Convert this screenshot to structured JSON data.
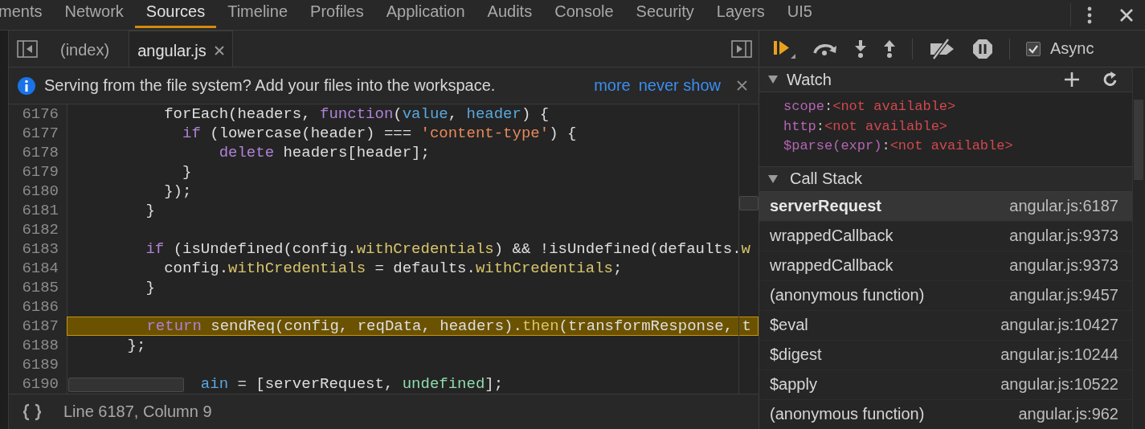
{
  "top_tabs": [
    {
      "label": "ments",
      "selected": false
    },
    {
      "label": "Network",
      "selected": false
    },
    {
      "label": "Sources",
      "selected": true
    },
    {
      "label": "Timeline",
      "selected": false
    },
    {
      "label": "Profiles",
      "selected": false
    },
    {
      "label": "Application",
      "selected": false
    },
    {
      "label": "Audits",
      "selected": false
    },
    {
      "label": "Console",
      "selected": false
    },
    {
      "label": "Security",
      "selected": false
    },
    {
      "label": "Layers",
      "selected": false
    },
    {
      "label": "UI5",
      "selected": false
    }
  ],
  "file_tabs": [
    {
      "label": "(index)",
      "selected": false,
      "closable": false
    },
    {
      "label": "angular.js",
      "selected": true,
      "closable": true
    }
  ],
  "infobar": {
    "message": "Serving from the file system? Add your files into the workspace.",
    "links": [
      "more",
      "never show"
    ]
  },
  "editor": {
    "lines": [
      {
        "number": "6176",
        "current": false,
        "tokens": [
          {
            "kind": "plain",
            "text": "        forEach(headers, "
          },
          {
            "kind": "keyword",
            "text": "function"
          },
          {
            "kind": "plain",
            "text": "("
          },
          {
            "kind": "param",
            "text": "value"
          },
          {
            "kind": "plain",
            "text": ", "
          },
          {
            "kind": "param",
            "text": "header"
          },
          {
            "kind": "plain",
            "text": ") {"
          }
        ]
      },
      {
        "number": "6177",
        "current": false,
        "tokens": [
          {
            "kind": "keyword",
            "text": "          if"
          },
          {
            "kind": "plain",
            "text": " (lowercase(header) === "
          },
          {
            "kind": "string",
            "text": "'content-type'"
          },
          {
            "kind": "plain",
            "text": ") {"
          }
        ]
      },
      {
        "number": "6178",
        "current": false,
        "tokens": [
          {
            "kind": "keyword",
            "text": "              delete"
          },
          {
            "kind": "plain",
            "text": " headers[header];"
          }
        ]
      },
      {
        "number": "6179",
        "current": false,
        "tokens": [
          {
            "kind": "plain",
            "text": "          }"
          }
        ]
      },
      {
        "number": "6180",
        "current": false,
        "tokens": [
          {
            "kind": "plain",
            "text": "        });"
          }
        ]
      },
      {
        "number": "6181",
        "current": false,
        "tokens": [
          {
            "kind": "plain",
            "text": "      }"
          }
        ]
      },
      {
        "number": "6182",
        "current": false
      },
      {
        "number": "6183",
        "current": false,
        "tokens": [
          {
            "kind": "keyword",
            "text": "      if"
          },
          {
            "kind": "plain",
            "text": " (isUndefined(config."
          },
          {
            "kind": "property",
            "text": "withCredentials"
          },
          {
            "kind": "plain",
            "text": ") && !isUndefined(defaults."
          },
          {
            "kind": "property",
            "text": "w"
          }
        ]
      },
      {
        "number": "6184",
        "current": false,
        "tokens": [
          {
            "kind": "plain",
            "text": "        config."
          },
          {
            "kind": "property",
            "text": "withCredentials"
          },
          {
            "kind": "plain",
            "text": " = defaults."
          },
          {
            "kind": "property",
            "text": "withCredentials"
          },
          {
            "kind": "plain",
            "text": ";"
          }
        ]
      },
      {
        "number": "6185",
        "current": false,
        "tokens": [
          {
            "kind": "plain",
            "text": "      }"
          }
        ]
      },
      {
        "number": "6186",
        "current": false
      },
      {
        "number": "6187",
        "current": true,
        "tokens": [
          {
            "kind": "keyword",
            "text": "      return"
          },
          {
            "kind": "plain",
            "text": " sendReq(config, reqData, headers)."
          },
          {
            "kind": "property",
            "text": "then"
          },
          {
            "kind": "plain",
            "text": "(transformResponse, t"
          }
        ]
      },
      {
        "number": "6188",
        "current": false,
        "tokens": [
          {
            "kind": "plain",
            "text": "    };"
          }
        ]
      },
      {
        "number": "6189",
        "current": false
      },
      {
        "number": "6190",
        "current": false,
        "tokens": [
          {
            "kind": "param",
            "text": "            ain"
          },
          {
            "kind": "plain",
            "text": " = [serverRequest, "
          },
          {
            "kind": "literal",
            "text": "undefined"
          },
          {
            "kind": "plain",
            "text": "];"
          }
        ]
      }
    ]
  },
  "status_bar": {
    "position": "Line 6187, Column 9"
  },
  "debugger": {
    "async": {
      "label": "Async",
      "checked": true
    },
    "watch": {
      "title": "Watch",
      "expanded": true,
      "items": [
        {
          "name": "scope",
          "separator": ":",
          "value": "<not available>"
        },
        {
          "name": "http",
          "separator": ":",
          "value": "<not available>"
        },
        {
          "name": "$parse(expr)",
          "separator": ":",
          "value": "<not available>"
        }
      ]
    },
    "call_stack": {
      "title": "Call Stack",
      "expanded": true,
      "frames": [
        {
          "function": "serverRequest",
          "location": "angular.js:6187",
          "selected": true
        },
        {
          "function": "wrappedCallback",
          "location": "angular.js:9373",
          "selected": false
        },
        {
          "function": "wrappedCallback",
          "location": "angular.js:9373",
          "selected": false
        },
        {
          "function": "(anonymous function)",
          "location": "angular.js:9457",
          "selected": false
        },
        {
          "function": "$eval",
          "location": "angular.js:10427",
          "selected": false
        },
        {
          "function": "$digest",
          "location": "angular.js:10244",
          "selected": false
        },
        {
          "function": "$apply",
          "location": "angular.js:10522",
          "selected": false
        },
        {
          "function": "(anonymous function)",
          "location": "angular.js:962",
          "selected": false
        }
      ]
    }
  }
}
